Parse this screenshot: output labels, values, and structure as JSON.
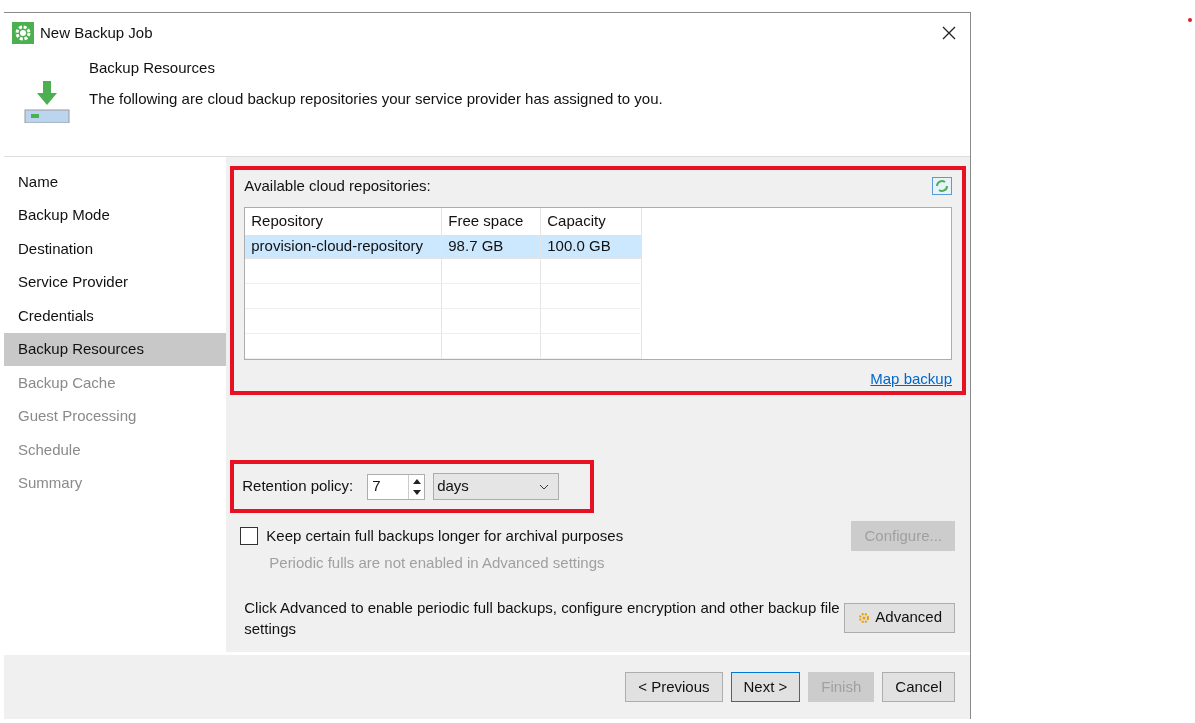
{
  "window": {
    "title": "New Backup Job"
  },
  "header": {
    "title": "Backup Resources",
    "description": "The following are cloud backup repositories your service provider has assigned to you."
  },
  "sidebar": {
    "items": [
      {
        "label": "Name",
        "selected": false,
        "disabled": false
      },
      {
        "label": "Backup Mode",
        "selected": false,
        "disabled": false
      },
      {
        "label": "Destination",
        "selected": false,
        "disabled": false
      },
      {
        "label": "Service Provider",
        "selected": false,
        "disabled": false
      },
      {
        "label": "Credentials",
        "selected": false,
        "disabled": false
      },
      {
        "label": "Backup Resources",
        "selected": true,
        "disabled": false
      },
      {
        "label": "Backup Cache",
        "selected": false,
        "disabled": true
      },
      {
        "label": "Guest Processing",
        "selected": false,
        "disabled": true
      },
      {
        "label": "Schedule",
        "selected": false,
        "disabled": true
      },
      {
        "label": "Summary",
        "selected": false,
        "disabled": true
      }
    ]
  },
  "repositories": {
    "label": "Available cloud repositories:",
    "columns": [
      "Repository",
      "Free space",
      "Capacity"
    ],
    "rows": [
      {
        "cells": [
          "provision-cloud-repository",
          "98.7 GB",
          "100.0 GB"
        ],
        "selected": true
      }
    ],
    "link": "Map backup"
  },
  "retention": {
    "label": "Retention policy:",
    "value": "7",
    "unit": "days"
  },
  "archival": {
    "label": "Keep certain full backups longer for archival purposes",
    "checked": false,
    "note": "Periodic fulls are not enabled in Advanced settings",
    "button": "Configure...",
    "button_disabled": true
  },
  "advanced": {
    "text": "Click Advanced to enable periodic full backups, configure encryption and other backup file settings",
    "button": "Advanced"
  },
  "footer": {
    "buttons": [
      {
        "label": "< Previous",
        "disabled": false,
        "default": false
      },
      {
        "label": "Next >",
        "disabled": false,
        "default": true
      },
      {
        "label": "Finish",
        "disabled": true,
        "default": false
      },
      {
        "label": "Cancel",
        "disabled": false,
        "default": false
      }
    ]
  }
}
